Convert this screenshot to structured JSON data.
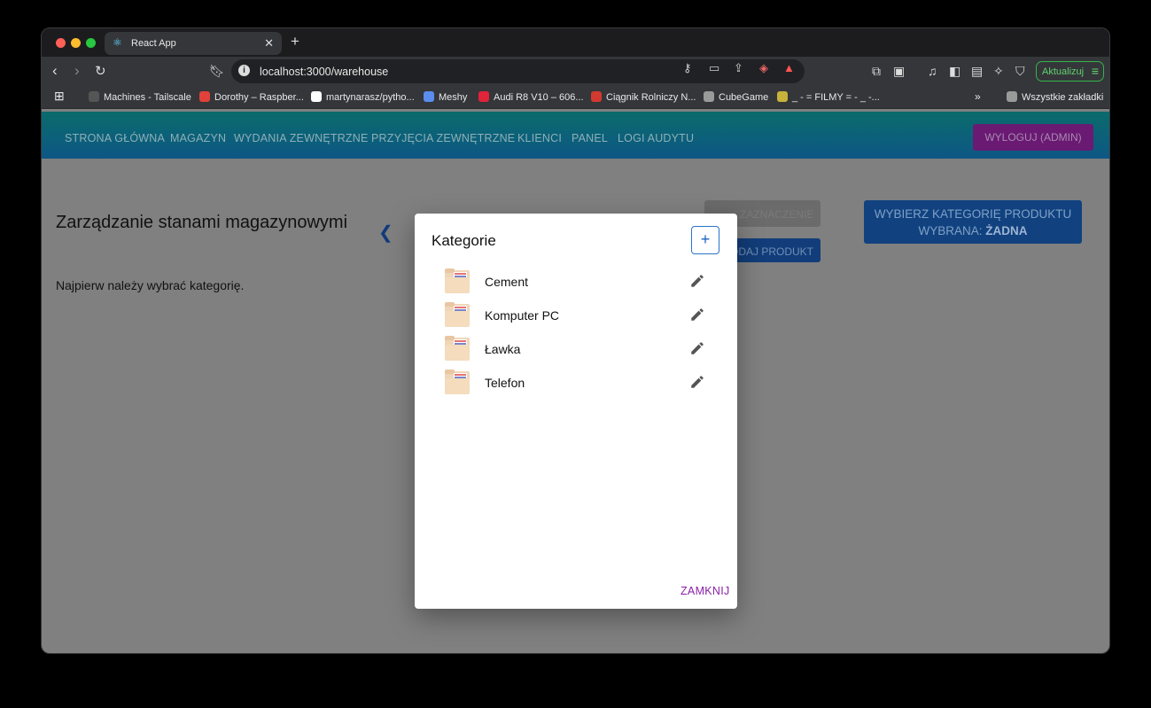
{
  "browser": {
    "tab_title": "React App",
    "url": "localhost:3000/warehouse",
    "update_label": "Aktualizuj"
  },
  "bookmarks": [
    {
      "label": "Machines - Tailscale",
      "color": "#555555"
    },
    {
      "label": "Dorothy – Raspber...",
      "color": "#e0413a"
    },
    {
      "label": "martynarasz/pytho...",
      "color": "#ffffff"
    },
    {
      "label": "Meshy",
      "color": "#5b8def"
    },
    {
      "label": "Audi R8 V10 – 606...",
      "color": "#e0243a"
    },
    {
      "label": "Ciągnik Rolniczy N...",
      "color": "#d23a2f"
    },
    {
      "label": "CubeGame",
      "color": "#9a9a9a"
    },
    {
      "label": "_ - = FILMY = - _ -...",
      "color": "#c9b23a"
    }
  ],
  "bookmarks_all": "Wszystkie zakładki",
  "appbar": {
    "links": [
      "STRONA GŁÓWNA",
      "MAGAZYN",
      "WYDANIA ZEWNĘTRZNE",
      "PRZYJĘCIA ZEWNĘTRZNE",
      "KLIENCI",
      "PANEL",
      "LOGI AUDYTU"
    ],
    "logout": "WYLOGUJ (ADMIN)"
  },
  "page": {
    "title": "Zarządzanie stanami magazynowymi",
    "note": "Najpierw należy wybrać kategorię.",
    "select_label": "ZAZNACZENIE",
    "add_product": "DODAJ PRODUKT",
    "category_button_line1": "WYBIERZ KATEGORIĘ PRODUKTU",
    "category_button_line2_prefix": "WYBRANA: ",
    "category_button_line2_value": "ŻADNA"
  },
  "modal": {
    "title": "Kategorie",
    "add_symbol": "+",
    "categories": [
      "Cement",
      "Komputer PC",
      "Ławka",
      "Telefon"
    ],
    "close": "ZAMKNIJ"
  }
}
